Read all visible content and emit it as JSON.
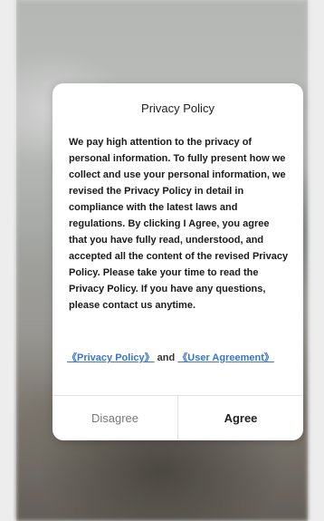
{
  "dialog": {
    "title": "Privacy Policy",
    "body": "We pay high attention to the privacy of personal information. To fully present how we collect and use your personal information, we revised the Privacy Policy in detail in compliance with the latest laws and regulations. By clicking I Agree, you agree that you have fully read, understood, and accepted all the content of the revised Privacy Policy. Please take your time to read the Privacy Policy. If you have any questions, please contact us anytime.",
    "links": {
      "privacy_policy": "《Privacy Policy》",
      "and": "and",
      "user_agreement": "《User Agreement》"
    },
    "buttons": {
      "disagree": "Disagree",
      "agree": "Agree"
    }
  },
  "colors": {
    "link": "#3a74c7",
    "dialog_bg": "#ffffff",
    "divider": "#e2e2e2"
  }
}
